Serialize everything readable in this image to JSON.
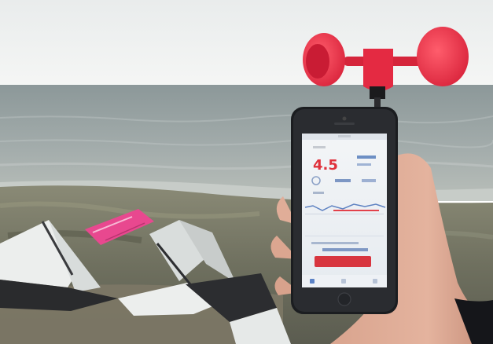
{
  "photo": {
    "subject": "phone-with-anemometer",
    "colors": {
      "sky": "#eef0ef",
      "sea": "#9aa4a4",
      "anemometer": "#ea2f45",
      "phone": "#1b1d20",
      "kite_pink": "#e8488f",
      "app_accent": "#d8353f"
    }
  },
  "app": {
    "wind_speed": "4.5"
  }
}
